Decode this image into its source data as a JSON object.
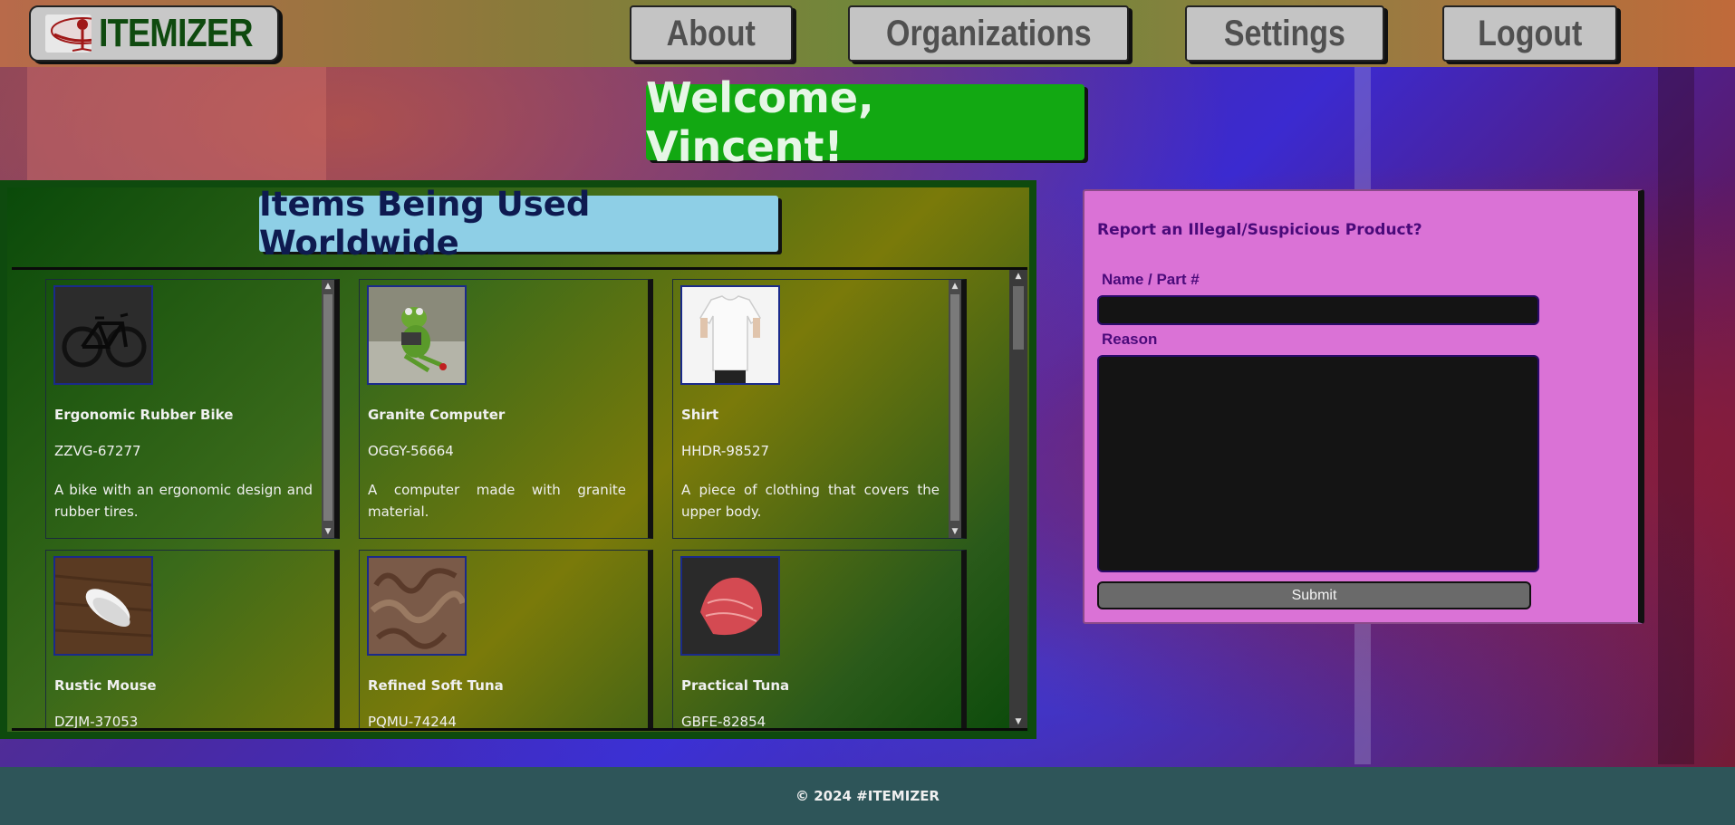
{
  "header": {
    "logo_text": "ITEMIZER",
    "nav": [
      "About",
      "Organizations",
      "Settings",
      "Logout"
    ]
  },
  "welcome": "Welcome, Vincent!",
  "items": {
    "title": "Items Being Used Worldwide",
    "cards": [
      {
        "name": "Ergonomic Rubber Bike",
        "code": "ZZVG-67277",
        "desc": "A bike with an ergonomic design and rubber tires.",
        "image": "bicycle"
      },
      {
        "name": "Granite Computer",
        "code": "OGGY-56664",
        "desc": "A computer made with granite material.",
        "image": "frog-figurine"
      },
      {
        "name": "Shirt",
        "code": "HHDR-98527",
        "desc": "A piece of clothing that covers the upper body.",
        "image": "white-tshirt"
      },
      {
        "name": "Rustic Mouse",
        "code": "DZJM-37053",
        "desc": "",
        "image": "computer-mouse"
      },
      {
        "name": "Refined Soft Tuna",
        "code": "PQMU-74244",
        "desc": "",
        "image": "raw-texture"
      },
      {
        "name": "Practical Tuna",
        "code": "GBFE-82854",
        "desc": "",
        "image": "tuna-steak"
      }
    ]
  },
  "report": {
    "title": "Report an Illegal/Suspicious Product?",
    "name_label": "Name / Part #",
    "name_value": "",
    "reason_label": "Reason",
    "reason_value": "",
    "submit_label": "Submit"
  },
  "footer": "© 2024 #ITEMIZER",
  "colors": {
    "welcome_bg": "#12a812",
    "title_bg": "#8ecfe6",
    "report_bg": "#da72d6",
    "footer_bg": "#2e5559"
  }
}
